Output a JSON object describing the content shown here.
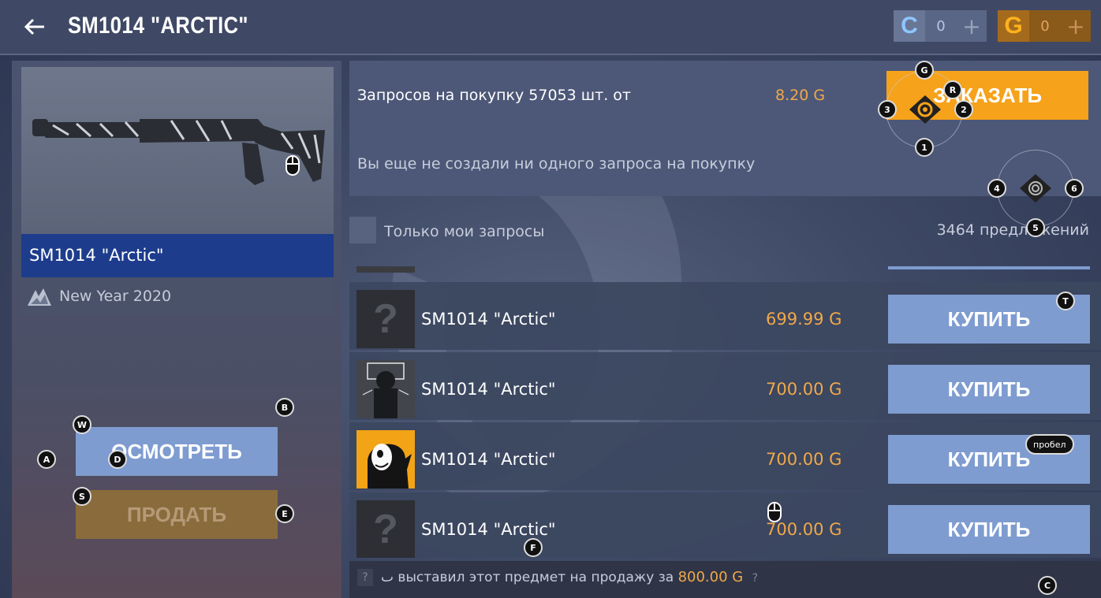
{
  "header": {
    "title": "SM1014 \"ARCTIC\"",
    "currency_c": {
      "symbol": "C",
      "value": "0",
      "plus": "+"
    },
    "currency_g": {
      "symbol": "G",
      "value": "0",
      "plus": "+"
    }
  },
  "item": {
    "name": "SM1014 \"Arctic\"",
    "collection": "New Year 2020"
  },
  "actions": {
    "inspect_label": "ОСМОТРЕТЬ",
    "sell_label": "ПРОДАТЬ"
  },
  "order": {
    "requests_text": "Запросов на покупку 57053 шт. от",
    "price": "8.20 G",
    "order_label": "ЗАКАЗАТЬ",
    "empty_text": "Вы еще не создали ни одного запроса на покупку"
  },
  "filter": {
    "only_mine_label": "Только мои запросы",
    "offers_count": "3464 предложений"
  },
  "listings": [
    {
      "name": "SM1014 \"Arctic\"",
      "price": "699.99 G",
      "buy_label": "КУПИТЬ",
      "avatar": "?"
    },
    {
      "name": "SM1014 \"Arctic\"",
      "price": "700.00 G",
      "buy_label": "КУПИТЬ",
      "avatar": ""
    },
    {
      "name": "SM1014 \"Arctic\"",
      "price": "700.00 G",
      "buy_label": "КУПИТЬ",
      "avatar": ""
    },
    {
      "name": "SM1014 \"Arctic\"",
      "price": "700.00 G",
      "buy_label": "КУПИТЬ",
      "avatar": "?"
    }
  ],
  "history": {
    "q": "?",
    "text": "ٮ выставил этот предмет на продажу за",
    "price": "800.00 G",
    "q2": "?"
  },
  "hints": {
    "W": "W",
    "A": "A",
    "S": "S",
    "D": "D",
    "B": "B",
    "E": "E",
    "G": "G",
    "R": "R",
    "1": "1",
    "2": "2",
    "3": "3",
    "4": "4",
    "5": "5",
    "6": "6",
    "T": "T",
    "F": "F",
    "C": "C",
    "space": "пробел"
  }
}
